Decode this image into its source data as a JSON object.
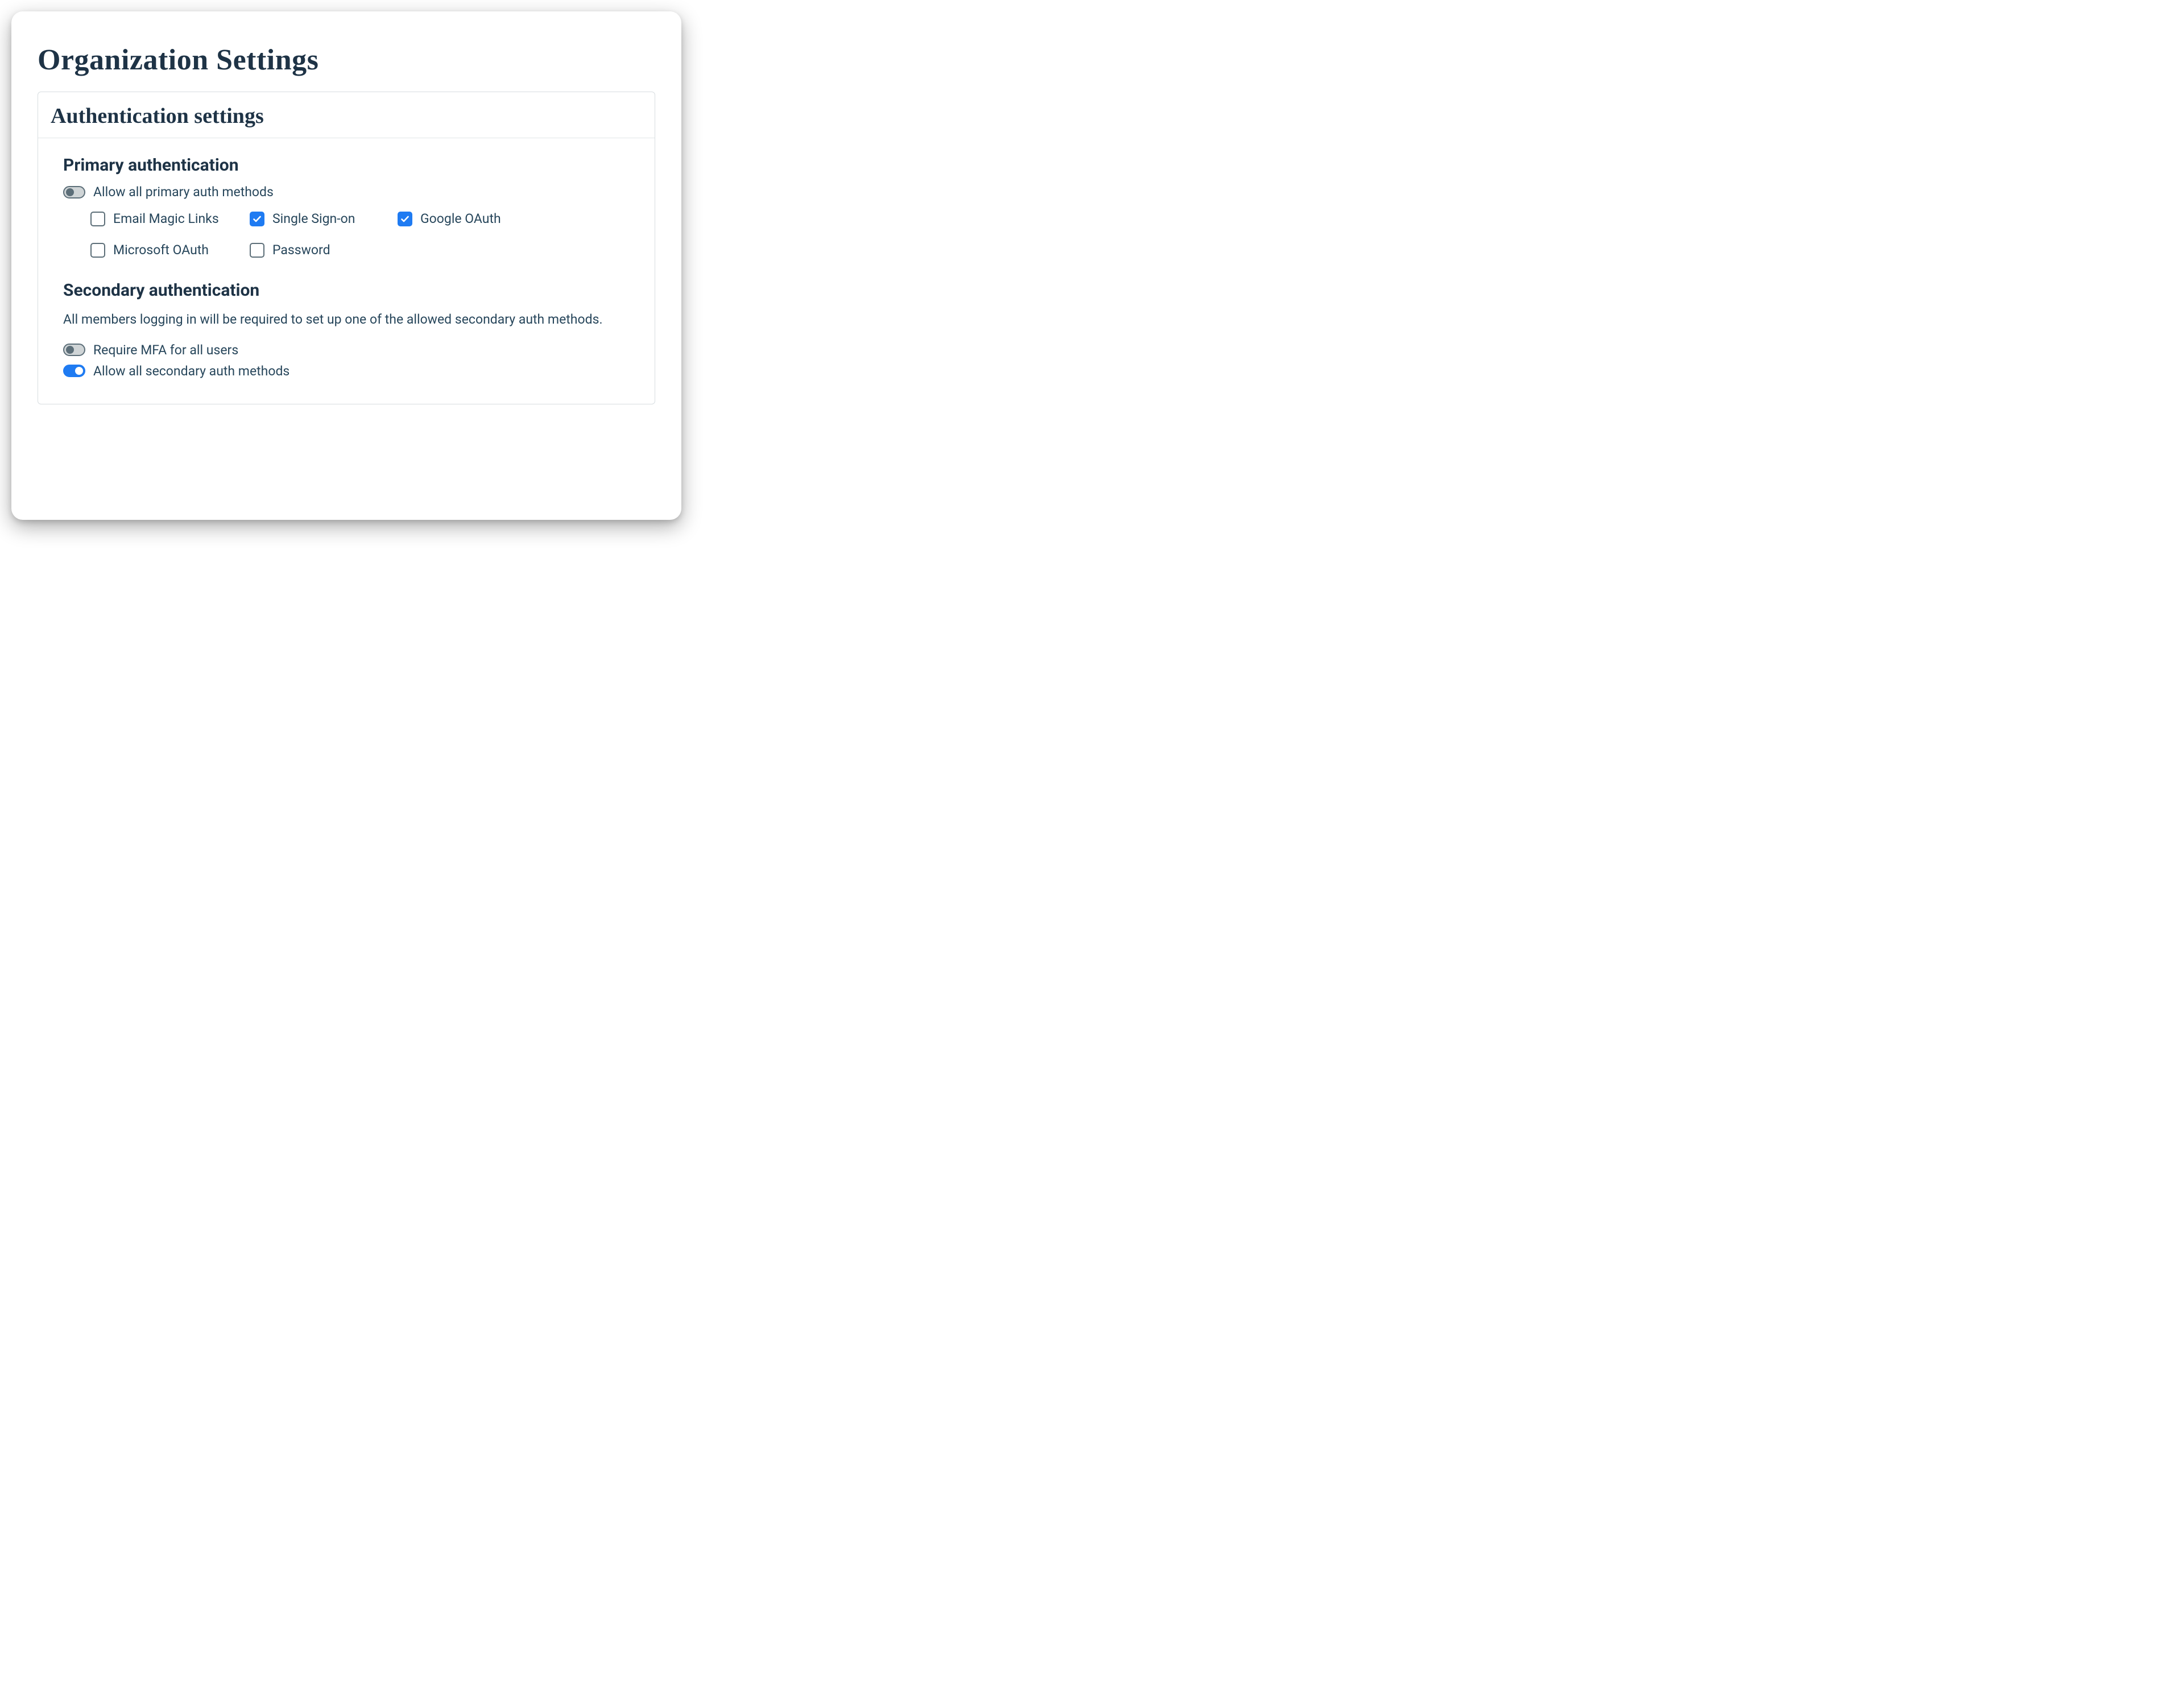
{
  "page": {
    "title": "Organization Settings"
  },
  "panel": {
    "title": "Authentication settings",
    "primary": {
      "heading": "Primary authentication",
      "allow_all": {
        "label": "Allow all primary auth methods",
        "enabled": false
      },
      "methods": [
        {
          "id": "email-magic-links",
          "label": "Email Magic Links",
          "checked": false
        },
        {
          "id": "single-sign-on",
          "label": "Single Sign-on",
          "checked": true
        },
        {
          "id": "google-oauth",
          "label": "Google OAuth",
          "checked": true
        },
        {
          "id": "microsoft-oauth",
          "label": "Microsoft OAuth",
          "checked": false
        },
        {
          "id": "password",
          "label": "Password",
          "checked": false
        }
      ]
    },
    "secondary": {
      "heading": "Secondary authentication",
      "description": "All members logging in will be required to set up one of the allowed secondary auth methods.",
      "require_mfa": {
        "label": "Require MFA for all users",
        "enabled": false
      },
      "allow_all": {
        "label": "Allow all secondary auth methods",
        "enabled": true
      }
    }
  }
}
